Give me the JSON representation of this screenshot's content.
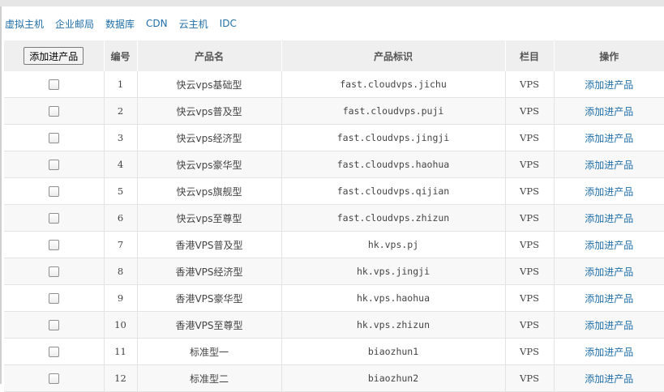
{
  "nav": {
    "items": [
      "虚拟主机",
      "企业邮局",
      "数据库",
      "CDN",
      "云主机",
      "IDC"
    ]
  },
  "toolbar": {
    "add_button_label": "添加进产品"
  },
  "table": {
    "headers": [
      "编号",
      "产品名",
      "产品标识",
      "栏目",
      "操作"
    ],
    "rows": [
      {
        "id": "1",
        "name": "快云vps基础型",
        "code": "fast.cloudvps.jichu",
        "category": "VPS",
        "action": "添加进产品"
      },
      {
        "id": "2",
        "name": "快云vps普及型",
        "code": "fast.cloudvps.puji",
        "category": "VPS",
        "action": "添加进产品"
      },
      {
        "id": "3",
        "name": "快云vps经济型",
        "code": "fast.cloudvps.jingji",
        "category": "VPS",
        "action": "添加进产品"
      },
      {
        "id": "4",
        "name": "快云vps豪华型",
        "code": "fast.cloudvps.haohua",
        "category": "VPS",
        "action": "添加进产品"
      },
      {
        "id": "5",
        "name": "快云vps旗舰型",
        "code": "fast.cloudvps.qijian",
        "category": "VPS",
        "action": "添加进产品"
      },
      {
        "id": "6",
        "name": "快云vps至尊型",
        "code": "fast.cloudvps.zhizun",
        "category": "VPS",
        "action": "添加进产品"
      },
      {
        "id": "7",
        "name": "香港VPS普及型",
        "code": "hk.vps.pj",
        "category": "VPS",
        "action": "添加进产品"
      },
      {
        "id": "8",
        "name": "香港VPS经济型",
        "code": "hk.vps.jingji",
        "category": "VPS",
        "action": "添加进产品"
      },
      {
        "id": "9",
        "name": "香港VPS豪华型",
        "code": "hk.vps.haohua",
        "category": "VPS",
        "action": "添加进产品"
      },
      {
        "id": "10",
        "name": "香港VPS至尊型",
        "code": "hk.vps.zhizun",
        "category": "VPS",
        "action": "添加进产品"
      },
      {
        "id": "11",
        "name": "标准型一",
        "code": "biaozhun1",
        "category": "VPS",
        "action": "添加进产品"
      },
      {
        "id": "12",
        "name": "标准型二",
        "code": "biaozhun2",
        "category": "VPS",
        "action": "添加进产品"
      }
    ]
  },
  "colors": {
    "link": "#1f6fa8",
    "header_bg": "#efefef",
    "stripe_bg": "#f8f8f8",
    "border": "#e3e3e3"
  }
}
